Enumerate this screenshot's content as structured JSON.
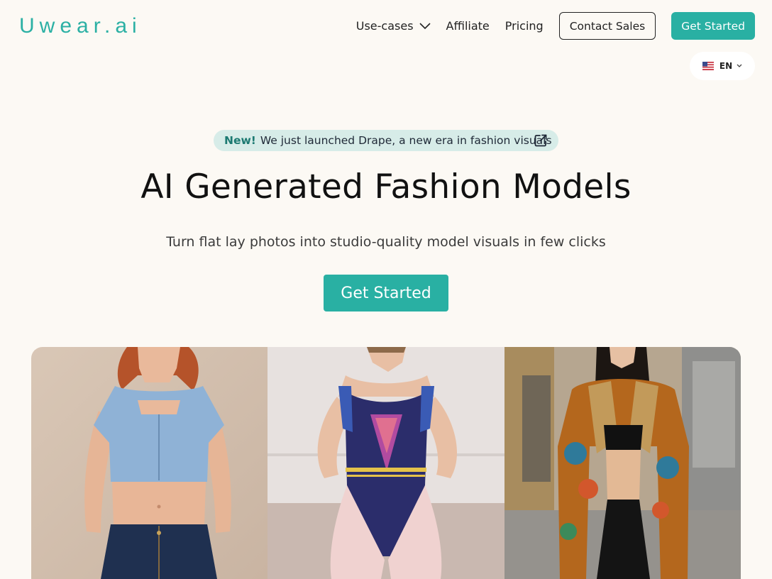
{
  "brand": {
    "logo_text": "Uwear.ai",
    "accent": "#29b0a3"
  },
  "nav": {
    "use_cases_label": "Use-cases",
    "affiliate_label": "Affiliate",
    "pricing_label": "Pricing",
    "contact_sales_label": "Contact Sales",
    "get_started_label": "Get Started"
  },
  "language": {
    "selected": "EN",
    "flag_icon": "us-flag-icon"
  },
  "announcement": {
    "badge": "New!",
    "text": "We just launched Drape, a new era in fashion visuals",
    "icon": "external-link-icon"
  },
  "hero": {
    "title": "AI Generated Fashion Models",
    "subtitle": "Turn flat lay photos into studio-quality model visuals in few clicks",
    "cta_label": "Get Started"
  }
}
